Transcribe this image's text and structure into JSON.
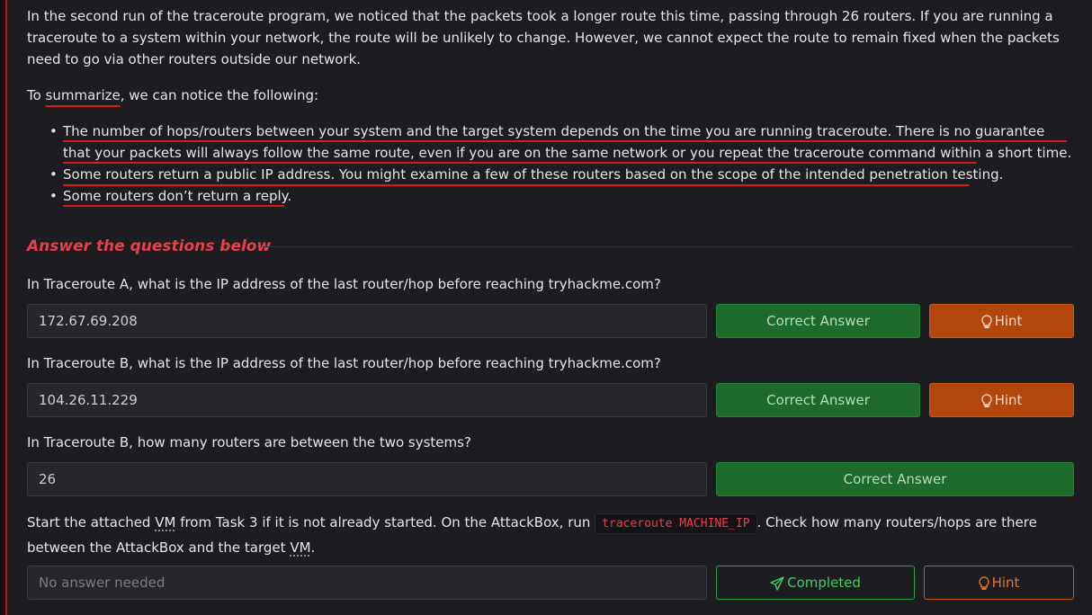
{
  "intro_paragraph": "In the second run of the traceroute program, we noticed that the packets took a longer route this time, passing through 26 routers. If you are running a traceroute to a system within your network, the route will be unlikely to change. However, we cannot expect the route to remain fixed when the packets need to go via other routers outside our network.",
  "summary_prefix": "To ",
  "summary_word": "summarize",
  "summary_suffix": ", we can notice the following:",
  "bullets": [
    "The number of hops/routers between your system and the target system depends on the time you are running traceroute. There is no guarantee that your packets will always follow the same route, even if you are on the same network or you repeat the traceroute command within a short time.",
    "Some routers return a public IP address. You might examine a few of these routers based on the scope of the intended penetration testing.",
    "Some routers don’t return a reply."
  ],
  "answer_section_title": "Answer the questions below",
  "questions": [
    {
      "text": "In Traceroute A, what is the IP address of the last router/hop before reaching tryhackme.com?",
      "answer": "172.67.69.208",
      "button": "Correct Answer",
      "hint": "Hint"
    },
    {
      "text": "In Traceroute B, what is the IP address of the last router/hop before reaching tryhackme.com?",
      "answer": "104.26.11.229",
      "button": "Correct Answer",
      "hint": "Hint"
    },
    {
      "text": "In Traceroute B, how many routers are between the two systems?",
      "answer": "26",
      "button": "Correct Answer"
    }
  ],
  "q4": {
    "text_a": "Start the attached ",
    "vm1": "VM",
    "text_b": " from Task 3 if it is not already started. On the AttackBox, run ",
    "code": "traceroute MACHINE_IP",
    "text_c": ". Check how many routers/hops are there between the AttackBox and the target ",
    "vm2": "VM",
    "text_d": ".",
    "placeholder": "No answer needed",
    "button": "Completed",
    "hint": "Hint"
  },
  "colors": {
    "accent_red": "#e8404a",
    "underline_red": "#d81a1a",
    "correct_green": "#1d6a2a",
    "hint_orange": "#b3470b",
    "completed_green": "#3ccf66"
  }
}
